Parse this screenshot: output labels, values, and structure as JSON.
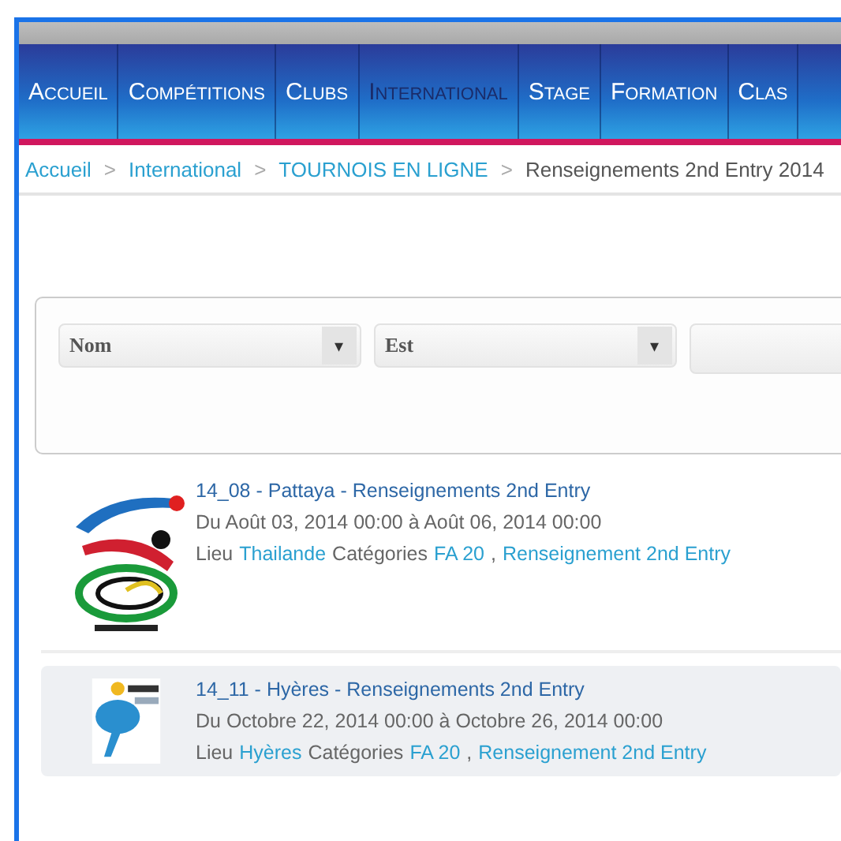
{
  "nav": {
    "items": [
      {
        "label": "Accueil",
        "selected": false
      },
      {
        "label": "Compétitions",
        "selected": false
      },
      {
        "label": "Clubs",
        "selected": false
      },
      {
        "label": "International",
        "selected": true
      },
      {
        "label": "Stage",
        "selected": false
      },
      {
        "label": "Formation",
        "selected": false
      },
      {
        "label": "Clas",
        "selected": false
      }
    ]
  },
  "breadcrumb": [
    {
      "label": "Accueil",
      "current": false
    },
    {
      "sep": ">",
      "label": "International",
      "current": false
    },
    {
      "sep": ">",
      "label": "TOURNOIS EN LIGNE",
      "current": false
    },
    {
      "sep": ">",
      "label": "Renseignements 2nd Entry 2014",
      "current": true
    }
  ],
  "filters": [
    {
      "kind": "dropdown",
      "value": "Nom",
      "caret": "▾"
    },
    {
      "kind": "dropdown",
      "value": "Est",
      "caret": "▾"
    },
    {
      "kind": "field"
    }
  ],
  "events": [
    {
      "kind": "picture",
      "hovered": false,
      "title": "14_08 - Pattaya - Renseignements 2nd Entry",
      "dates": "Du Août 03, 2014 00:00 à Août 06, 2014 00:00",
      "lieu_label": "Lieu",
      "lieu": "Thailande",
      "categories_label": "Catégories",
      "categories": [
        {
          "label": "FA 20"
        },
        {
          "sep": ",",
          "label": "Renseignement 2nd Entry"
        }
      ]
    },
    {
      "kind": "picture",
      "hovered": true,
      "title": "14_11 - Hyères - Renseignements 2nd Entry",
      "dates": "Du Octobre 22, 2014 00:00 à Octobre 26, 2014 00:00",
      "lieu_label": "Lieu",
      "lieu": "Hyères",
      "categories_label": "Catégories",
      "categories": [
        {
          "label": "FA 20"
        },
        {
          "sep": ",",
          "label": "Renseignement 2nd Entry"
        }
      ]
    }
  ]
}
